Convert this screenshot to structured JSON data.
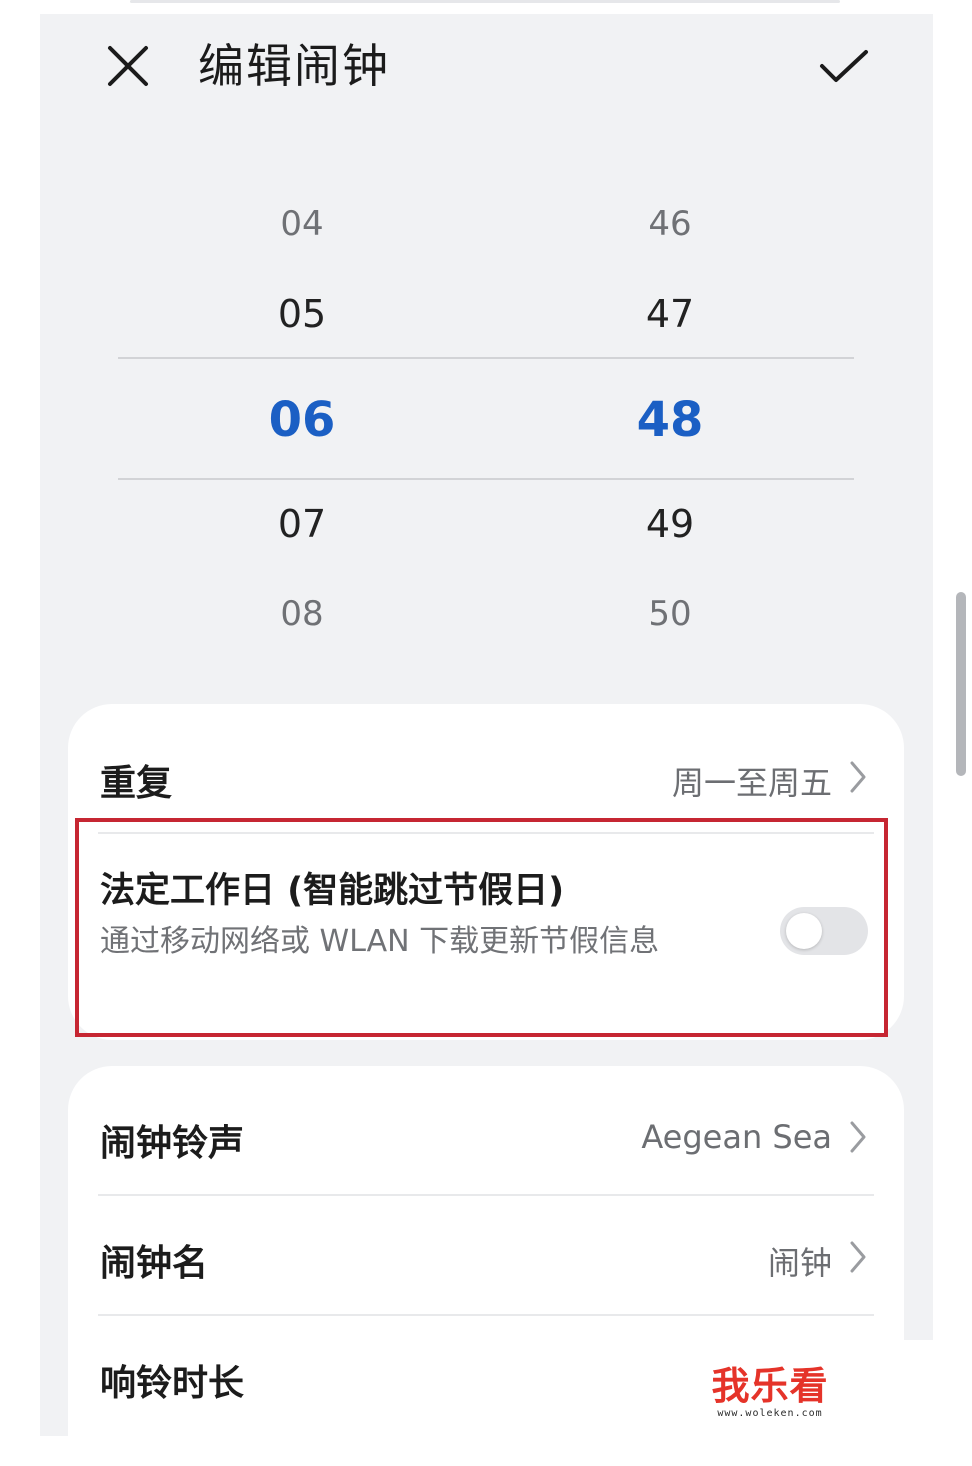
{
  "header": {
    "title": "编辑闹钟",
    "close_icon": "close-icon",
    "confirm_icon": "check-icon"
  },
  "time_picker": {
    "hours": [
      "04",
      "05",
      "06",
      "07",
      "08"
    ],
    "minutes": [
      "46",
      "47",
      "48",
      "49",
      "50"
    ],
    "selected_hour": "06",
    "selected_minute": "48",
    "accent_color": "#1b5fc4"
  },
  "settings_card_1": {
    "repeat": {
      "label": "重复",
      "value": "周一至周五"
    },
    "holiday": {
      "title": "法定工作日 (智能跳过节假日)",
      "subtitle": "通过移动网络或 WLAN 下载更新节假信息",
      "enabled": false
    }
  },
  "settings_card_2": {
    "ringtone": {
      "label": "闹钟铃声",
      "value": "Aegean Sea"
    },
    "alarm_name": {
      "label": "闹钟名",
      "value": "闹钟"
    },
    "ring_duration": {
      "label": "响铃时长"
    }
  },
  "highlight_color": "#c62632",
  "watermark": {
    "text": "我乐看",
    "url": "www.woleken.com"
  }
}
